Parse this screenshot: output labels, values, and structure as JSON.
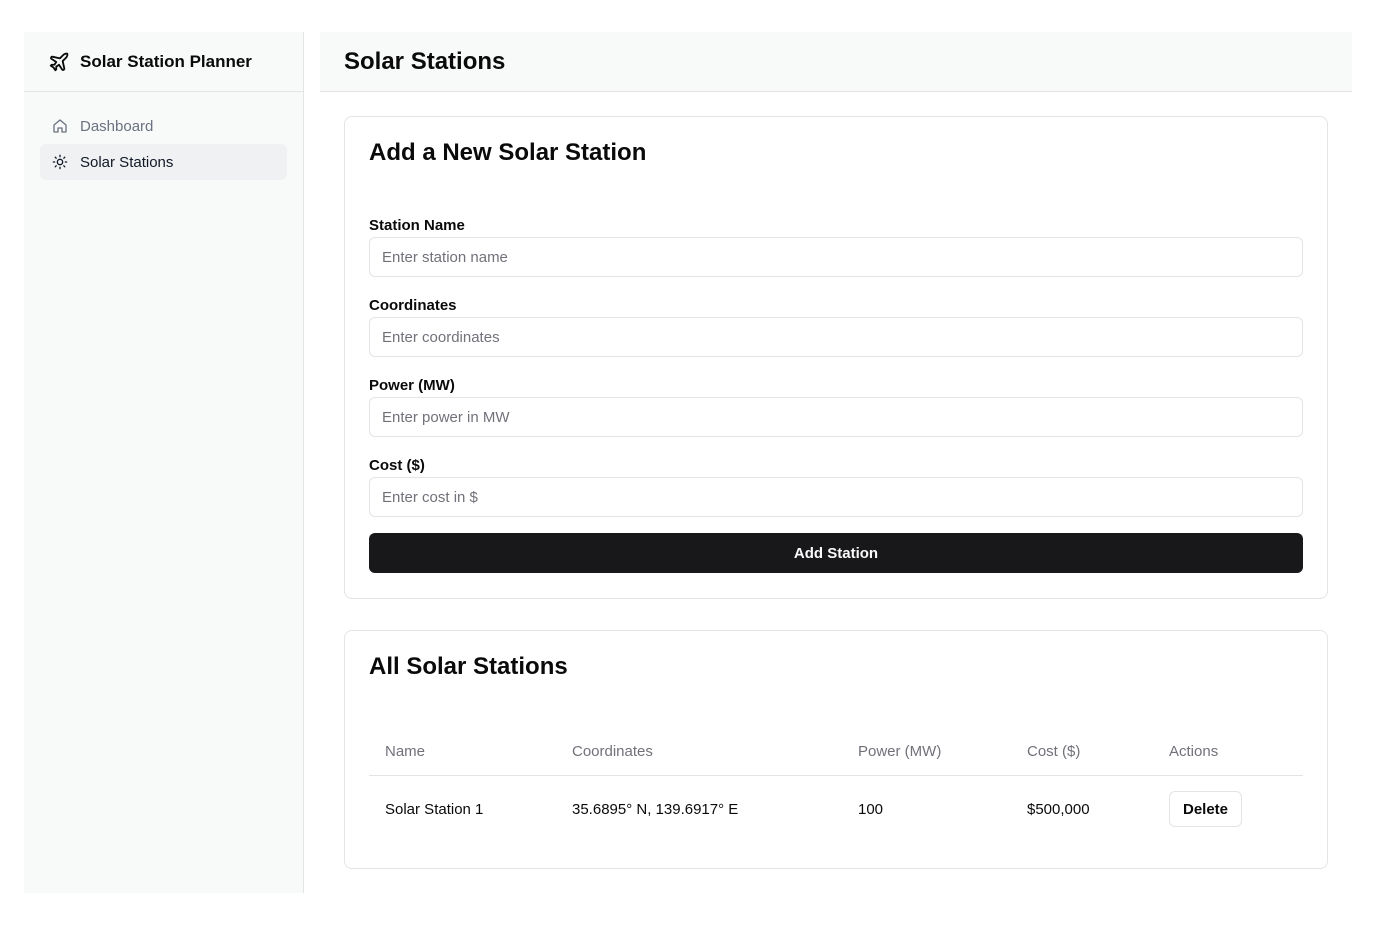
{
  "app": {
    "title": "Solar Station Planner"
  },
  "sidebar": {
    "items": [
      {
        "label": "Dashboard",
        "icon": "home-icon",
        "active": false
      },
      {
        "label": "Solar Stations",
        "icon": "sun-icon",
        "active": true
      }
    ]
  },
  "header": {
    "title": "Solar Stations"
  },
  "form": {
    "title": "Add a New Solar Station",
    "fields": [
      {
        "label": "Station Name",
        "placeholder": "Enter station name",
        "value": ""
      },
      {
        "label": "Coordinates",
        "placeholder": "Enter coordinates",
        "value": ""
      },
      {
        "label": "Power (MW)",
        "placeholder": "Enter power in MW",
        "value": ""
      },
      {
        "label": "Cost ($)",
        "placeholder": "Enter cost in $",
        "value": ""
      }
    ],
    "submit_label": "Add Station"
  },
  "table": {
    "title": "All Solar Stations",
    "columns": [
      "Name",
      "Coordinates",
      "Power (MW)",
      "Cost ($)",
      "Actions"
    ],
    "rows": [
      {
        "name": "Solar Station 1",
        "coordinates": "35.6895° N, 139.6917° E",
        "power": "100",
        "cost": "$500,000",
        "action_label": "Delete"
      }
    ]
  },
  "colors": {
    "sidebar_bg": "#f8f9f9",
    "border": "#e4e4e7",
    "primary": "#18181b",
    "muted_text": "#71717a"
  }
}
